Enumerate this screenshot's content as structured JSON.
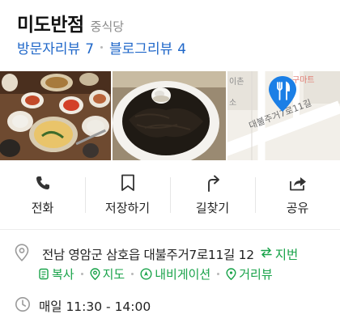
{
  "place": {
    "name": "미도반점",
    "category": "중식당"
  },
  "reviews": {
    "visitor_label": "방문자리뷰",
    "visitor_count": "7",
    "blog_label": "블로그리뷰",
    "blog_count": "4"
  },
  "photos": {
    "map_street_label": "대불주거7로11길",
    "map_corner_label_1": "이촌",
    "map_corner_label_2": "구마트",
    "map_side_label": "소",
    "map_marker_icon": "restaurant-pin-icon"
  },
  "actions": [
    {
      "label": "전화",
      "icon": "phone-icon"
    },
    {
      "label": "저장하기",
      "icon": "bookmark-icon"
    },
    {
      "label": "길찾기",
      "icon": "directions-icon"
    },
    {
      "label": "공유",
      "icon": "share-icon"
    }
  ],
  "info": {
    "address": "전남 영암군 삼호읍 대불주거7로11길 12",
    "jibun_label": "지번",
    "links": [
      {
        "label": "복사",
        "icon": "copy-icon"
      },
      {
        "label": "지도",
        "icon": "map-pin-icon"
      },
      {
        "label": "내비게이션",
        "icon": "navigation-icon"
      },
      {
        "label": "거리뷰",
        "icon": "street-view-icon"
      }
    ],
    "hours": "매일 11:30 - 14:00"
  },
  "colors": {
    "review_blue": "#1f67c9",
    "link_green": "#19a34a",
    "marker_blue": "#1b7fe6"
  }
}
